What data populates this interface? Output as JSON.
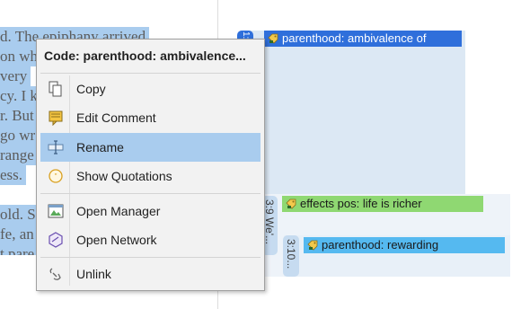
{
  "document": {
    "lines": [
      "d. The epiphany arrived",
      "on wh",
      "very",
      "cy. I k",
      "r. But",
      "go wr",
      "range",
      "ess.",
      "old. S",
      "fe, an",
      "t pare"
    ]
  },
  "margin": {
    "quote_tabs": [
      {
        "label": "1:1"
      },
      {
        "label": "3:9 We'..."
      },
      {
        "label": "3:10..."
      }
    ],
    "codes": [
      {
        "label": "parenthood: ambivalence of",
        "color": "#2f6fdb"
      },
      {
        "label": "effects pos: life is richer",
        "color": "#8fd872"
      },
      {
        "label": "parenthood: rewarding",
        "color": "#55b9f0"
      }
    ]
  },
  "context_menu": {
    "title": "Code: parenthood: ambivalence...",
    "items": [
      {
        "label": "Copy",
        "icon": "copy-icon",
        "highlighted": false
      },
      {
        "label": "Edit Comment",
        "icon": "comment-icon",
        "highlighted": false
      },
      {
        "label": "Rename",
        "icon": "rename-icon",
        "highlighted": true
      },
      {
        "label": "Show Quotations",
        "icon": "quotations-icon",
        "highlighted": false
      },
      {
        "label": "Open Manager",
        "icon": "manager-icon",
        "highlighted": false
      },
      {
        "label": "Open Network",
        "icon": "network-icon",
        "highlighted": false
      },
      {
        "label": "Unlink",
        "icon": "unlink-icon",
        "highlighted": false
      }
    ]
  },
  "colors": {
    "selection": "#a9ccee",
    "menu_background": "#f2f2f2"
  }
}
